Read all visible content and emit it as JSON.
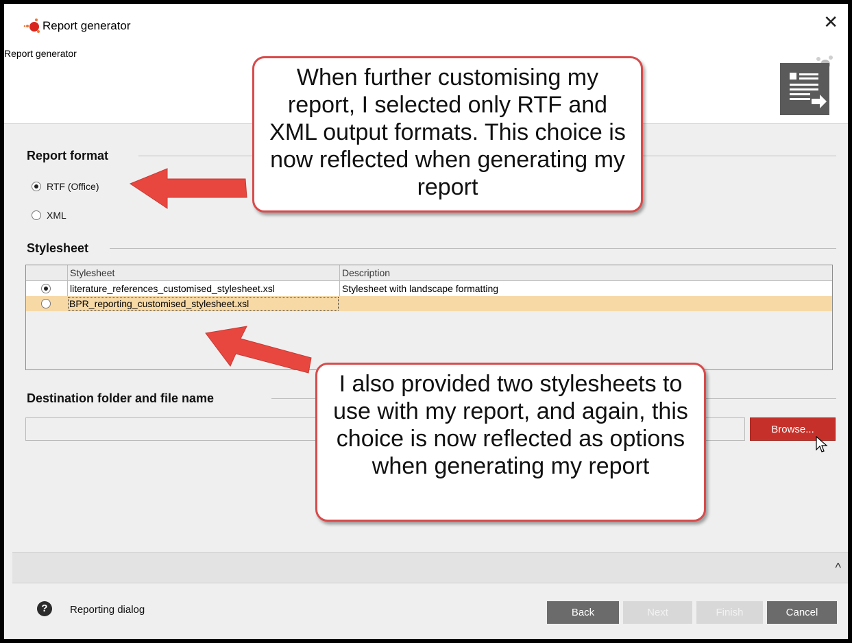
{
  "window": {
    "title": "Report generator",
    "subtitle": "Report generator"
  },
  "report_format": {
    "title": "Report format",
    "options": [
      {
        "label": "RTF (Office)",
        "selected": true
      },
      {
        "label": "XML",
        "selected": false
      }
    ]
  },
  "stylesheet": {
    "title": "Stylesheet",
    "columns": [
      "Stylesheet",
      "Description"
    ],
    "rows": [
      {
        "selected": true,
        "stylesheet": "literature_references_customised_stylesheet.xsl",
        "description": "Stylesheet with landscape formatting"
      },
      {
        "selected": false,
        "stylesheet": "BPR_reporting_customised_stylesheet.xsl",
        "description": ""
      }
    ]
  },
  "destination": {
    "title": "Destination folder and file name",
    "value": "",
    "browse_label": "Browse..."
  },
  "footer": {
    "help_icon": "?",
    "help_text": "Reporting dialog",
    "back_label": "Back",
    "next_label": "Next",
    "finish_label": "Finish",
    "cancel_label": "Cancel"
  },
  "callouts": {
    "top": "When further customising my report, I selected only RTF and XML output formats. This choice is now reflected when generating my report",
    "bottom": "I also provided two stylesheets to use with my report, and again, this choice is now reflected as options when generating my report"
  },
  "colors": {
    "accent": "#c5312a",
    "callout_border": "#d94a4a",
    "arrow": "#e8473f",
    "selected_row": "#f7d9a6"
  },
  "icons": [
    "app-logo-icon",
    "close-icon",
    "report-export-icon",
    "chevron-up-icon",
    "help-icon",
    "mouse-cursor-icon",
    "arrow-pointer-icon"
  ]
}
